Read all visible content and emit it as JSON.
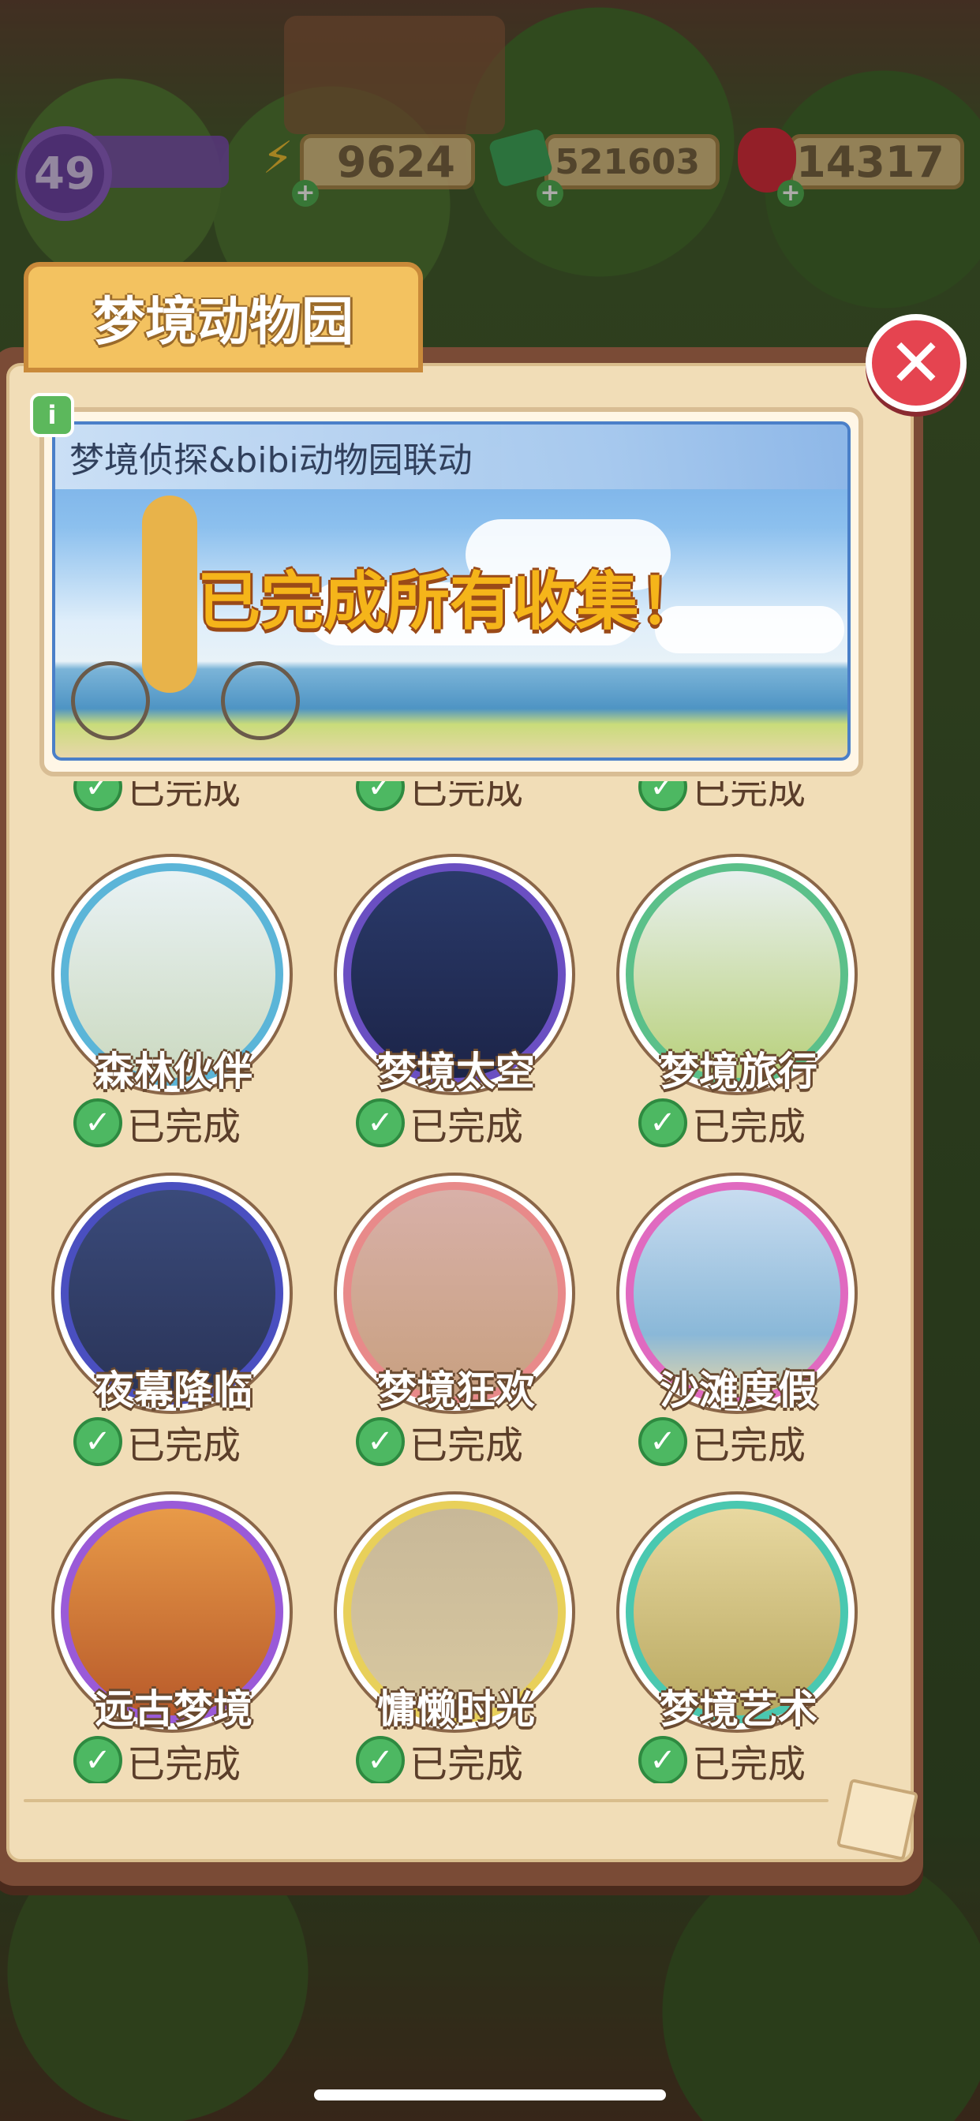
{
  "hud": {
    "level": "49",
    "energy": "9624",
    "cash": "521603",
    "gems": "14317"
  },
  "window": {
    "title": "梦境动物园",
    "close_symbol": "✕"
  },
  "banner": {
    "info_symbol": "i",
    "subtitle": "梦境侦探&bibi动物园联动",
    "message": "已完成所有收集！"
  },
  "collections": [
    {
      "name": "森林伙伴",
      "status": "已完成",
      "ring": "#5bb5d8"
    },
    {
      "name": "梦境太空",
      "status": "已完成",
      "ring": "#6a4fc2"
    },
    {
      "name": "梦境旅行",
      "status": "已完成",
      "ring": "#5bc08a"
    },
    {
      "name": "夜幕降临",
      "status": "已完成",
      "ring": "#4a4fc0"
    },
    {
      "name": "梦境狂欢",
      "status": "已完成",
      "ring": "#e88a8a"
    },
    {
      "name": "沙滩度假",
      "status": "已完成",
      "ring": "#e06ac0"
    },
    {
      "name": "远古梦境",
      "status": "已完成",
      "ring": "#9a5ad8"
    },
    {
      "name": "慵懒时光",
      "status": "已完成",
      "ring": "#e8d05a"
    },
    {
      "name": "梦境艺术",
      "status": "已完成",
      "ring": "#4ac8b0"
    }
  ],
  "cut_row_status": "已完成",
  "colors": {
    "check": "#4db862",
    "panel": "#7a4b36",
    "paper": "#f1ddb7",
    "close": "#e54450"
  },
  "icons": {
    "energy": "lightning-icon",
    "cash": "cash-icon",
    "gems": "ruby-icon",
    "check": "checkmark-icon"
  }
}
